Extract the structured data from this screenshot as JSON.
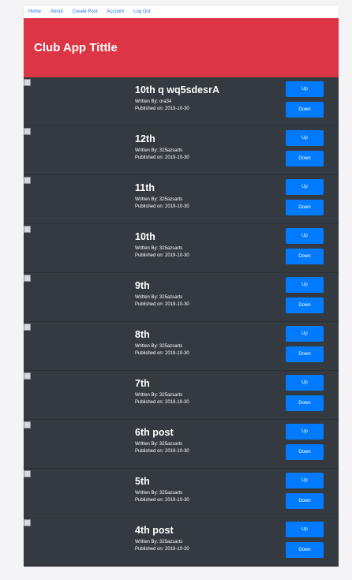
{
  "nav": {
    "items": [
      "Home",
      "About",
      "Create Post",
      "Account",
      "Log Out"
    ]
  },
  "banner": {
    "title": "Club App Tittle"
  },
  "post_labels": {
    "written_by": "Written By:",
    "published_on": "Published on:",
    "up": "Up",
    "down": "Down"
  },
  "posts": [
    {
      "title": "10th q wq5sdesrA",
      "author": "ora34",
      "date": "2019-10-30"
    },
    {
      "title": "12th",
      "author": "325azsarts",
      "date": "2019-10-30"
    },
    {
      "title": "11th",
      "author": "325azsarts",
      "date": "2019-10-30"
    },
    {
      "title": "10th",
      "author": "325azsarts",
      "date": "2019-10-30"
    },
    {
      "title": "9th",
      "author": "325azsarts",
      "date": "2019-10-30"
    },
    {
      "title": "8th",
      "author": "325azsarts",
      "date": "2019-10-30"
    },
    {
      "title": "7th",
      "author": "325azsarts",
      "date": "2019-10-30"
    },
    {
      "title": "6th post",
      "author": "325azsarts",
      "date": "2019-10-30"
    },
    {
      "title": "5th",
      "author": "325azsarts",
      "date": "2019-10-30"
    },
    {
      "title": "4th post",
      "author": "325azsarts",
      "date": "2019-10-30"
    }
  ]
}
